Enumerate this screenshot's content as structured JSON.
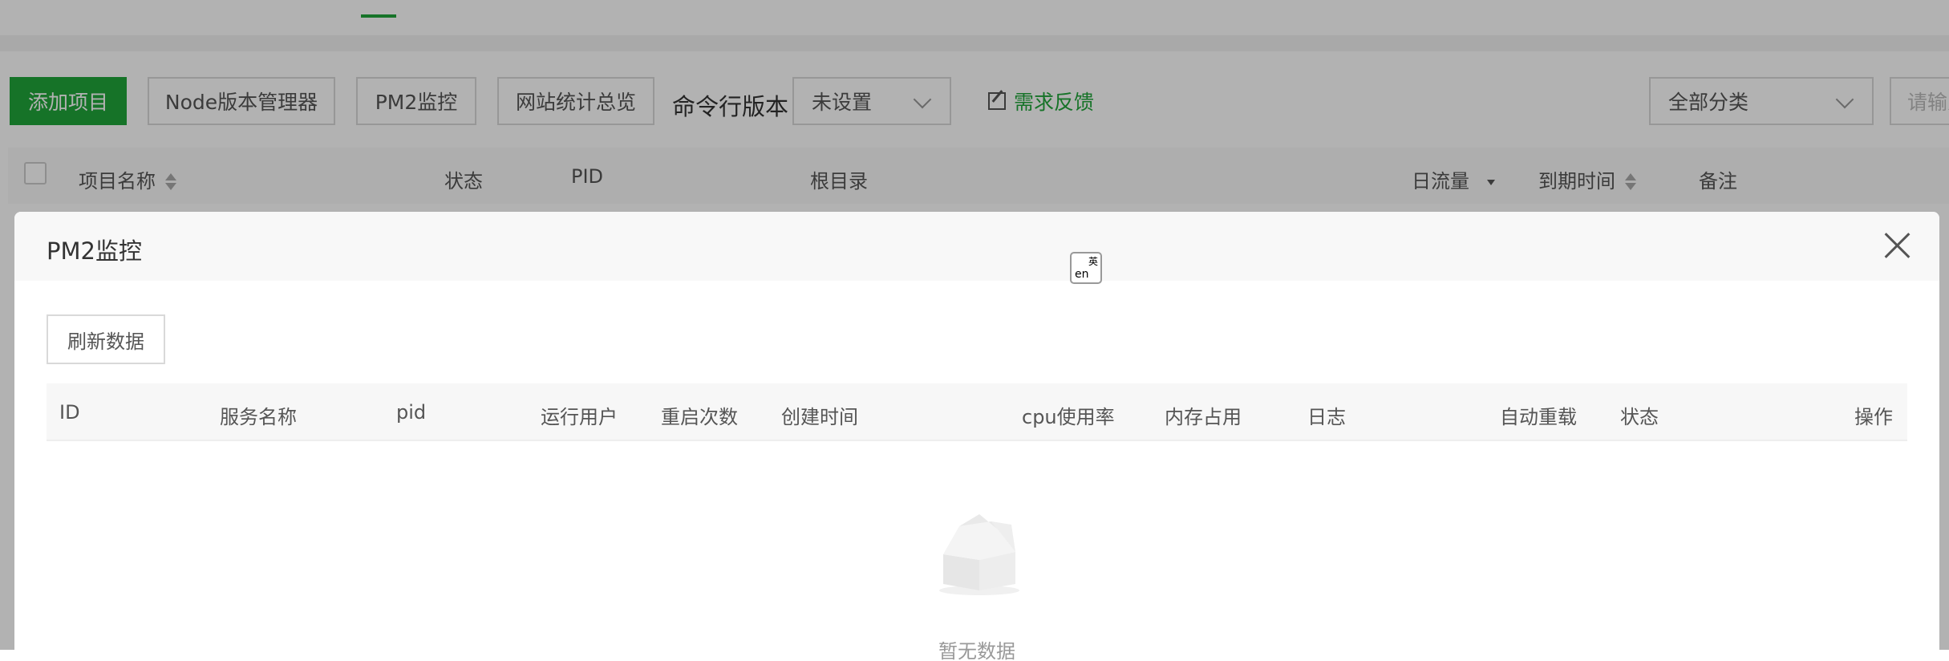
{
  "toolbar": {
    "add_project": "添加项目",
    "node_manager": "Node版本管理器",
    "pm2_monitor": "PM2监控",
    "site_stats": "网站统计总览",
    "cmd_version_label": "命令行版本",
    "cmd_version_value": "未设置",
    "feedback": "需求反馈",
    "category_value": "全部分类",
    "search_placeholder": "请输入"
  },
  "project_table": {
    "columns": [
      "项目名称",
      "状态",
      "PID",
      "根目录",
      "日流量",
      "到期时间",
      "备注"
    ]
  },
  "modal": {
    "title": "PM2监控",
    "translate_icon": {
      "en": "en",
      "zh": "英"
    },
    "refresh_button": "刷新数据",
    "columns": [
      "ID",
      "服务名称",
      "pid",
      "运行用户",
      "重启次数",
      "创建时间",
      "cpu使用率",
      "内存占用",
      "日志",
      "自动重载",
      "状态",
      "操作"
    ],
    "empty_text": "暂无数据"
  },
  "colors": {
    "accent": "#20a53a",
    "overlay": "rgba(0,0,0,0.3)",
    "header_bg": "#f8f8f8"
  }
}
